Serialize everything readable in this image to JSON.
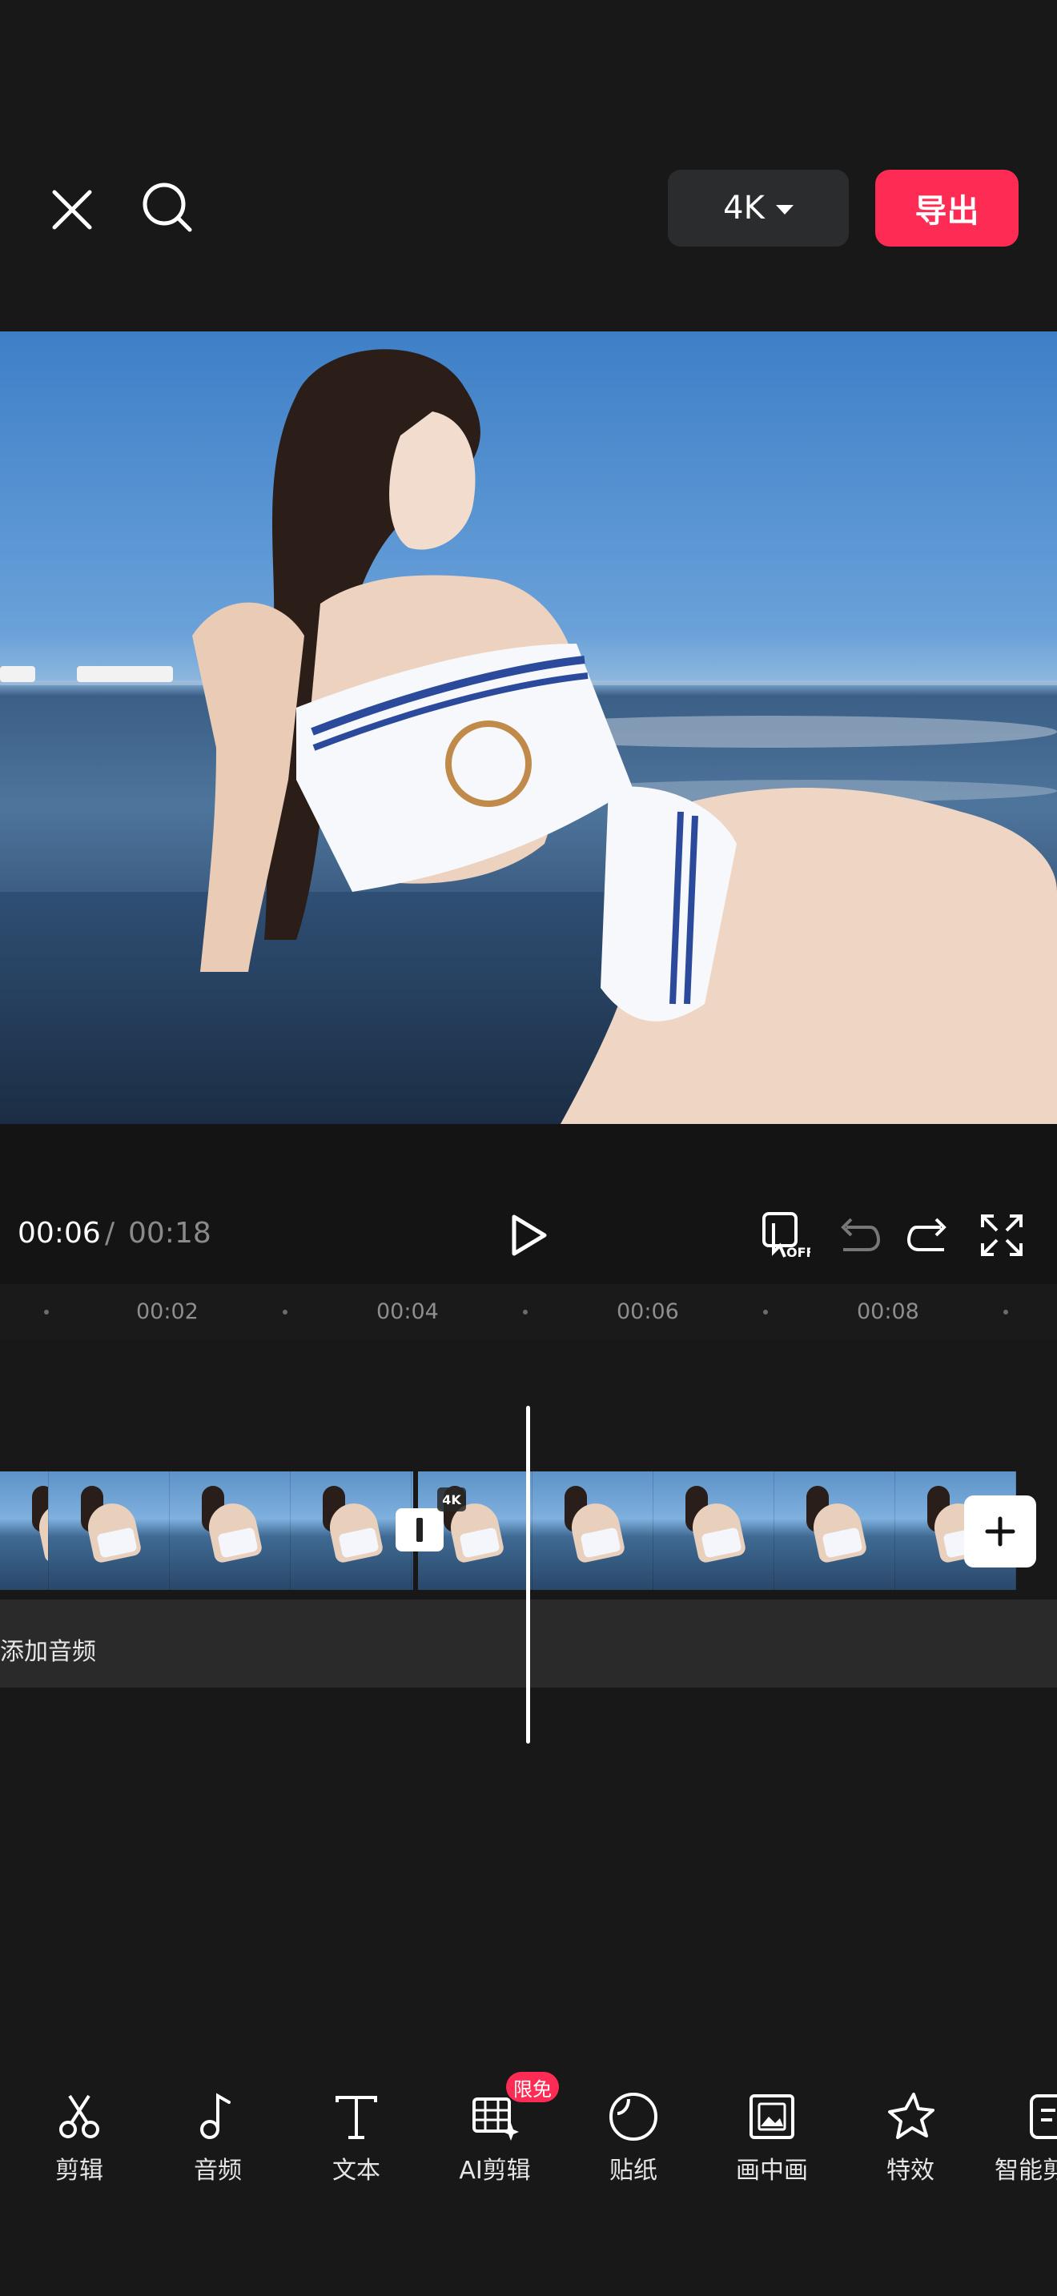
{
  "header": {
    "resolution_label": "4K",
    "export_label": "导出"
  },
  "playback": {
    "current_time": "00:06",
    "separator": "/",
    "total_time": "00:18"
  },
  "ruler": {
    "labels": [
      "00:02",
      "00:04",
      "00:06",
      "00:08"
    ]
  },
  "track": {
    "badge": "4K",
    "audio_label": "添加音频"
  },
  "toolbar": {
    "badge": "限免",
    "items": [
      {
        "label": "剪辑",
        "icon": "scissors-icon"
      },
      {
        "label": "音频",
        "icon": "music-note-icon"
      },
      {
        "label": "文本",
        "icon": "text-icon"
      },
      {
        "label": "AI剪辑",
        "icon": "ai-edit-icon"
      },
      {
        "label": "贴纸",
        "icon": "sticker-icon"
      },
      {
        "label": "画中画",
        "icon": "picture-in-picture-icon"
      },
      {
        "label": "特效",
        "icon": "effects-star-icon"
      },
      {
        "label": "智能剪",
        "icon": "smart-cut-icon"
      }
    ]
  },
  "colors": {
    "accent": "#fe2c55",
    "background": "#181818"
  }
}
